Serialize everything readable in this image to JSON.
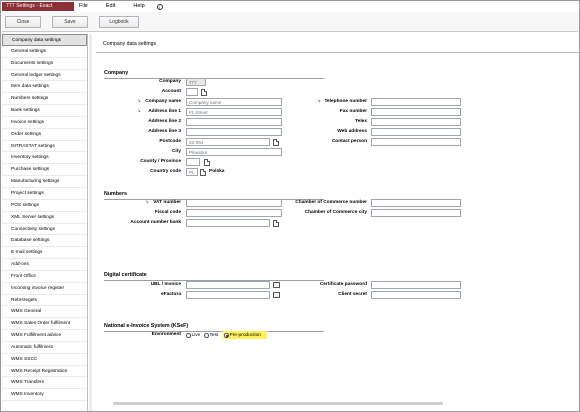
{
  "window": {
    "title": "777 Settings - Exact"
  },
  "menu": {
    "file": "File",
    "edit": "Edit",
    "help": "Help"
  },
  "toolbar": {
    "close": "Close",
    "save": "Save",
    "logbook": "Logbook"
  },
  "sidebar": {
    "items": [
      "Company data settings",
      "General settings",
      "Documents settings",
      "General ledger settings",
      "Item data settings",
      "Numbers settings",
      "Bank settings",
      "Invoice settings",
      "Order settings",
      "INTRASTAT settings",
      "Inventory settings",
      "Purchase settings",
      "Manufacturing settings",
      "Project settings",
      "POS settings",
      "XML Server settings",
      "Connectivity settings",
      "Database settings",
      "E-mail settings",
      "Add-ons",
      "Front Office",
      "Incoming invoice register",
      "Rebrsregels",
      "WMS General",
      "WMS Sales Order fulfilment",
      "WMS Fulfillment advice",
      "Automatic fulfilment",
      "WMS SSCC",
      "WMS Receipt Registration",
      "WMS Transfers",
      "WMS Inventory"
    ],
    "active_index": 0
  },
  "main": {
    "title": "Company data settings",
    "company": {
      "heading": "Company",
      "company_label": "Company",
      "company_value": "777",
      "account_label": "Account",
      "company_name_label": "Company name",
      "company_name_placeholder": "Company name",
      "address1_label": "Address line 1",
      "address1_value": "#1 Street",
      "address2_label": "Address line 2",
      "address3_label": "Address line 3",
      "postcode_label": "Postcode",
      "postcode_value": "62-064",
      "city_label": "City",
      "city_value": "Plewiska",
      "county_label": "County / Province",
      "country_label": "Country code",
      "country_value": "PL",
      "country_name": "Polska",
      "telephone_label": "Telephone number",
      "fax_label": "Fax number",
      "telex_label": "Telex",
      "web_label": "Web address",
      "contact_label": "Contact person"
    },
    "numbers": {
      "heading": "Numbers",
      "vat_label": "VAT number",
      "fiscal_label": "Fiscal code",
      "bank_label": "Account number bank",
      "coc_label": "Chamber of Commerce number",
      "coc_city_label": "Chamber of Commerce city"
    },
    "digital": {
      "heading": "Digital certificate",
      "ubl_label": "UBL / Invoice",
      "efactura_label": "eFactura",
      "cert_pwd_label": "Certificate password",
      "client_secret_label": "Client secret"
    },
    "ksef": {
      "heading": "National e-Invoice System (KSeF)",
      "environment_label": "Environment",
      "options": [
        "Live",
        "Test",
        "Pre-production"
      ],
      "selected": "Pre-production"
    }
  },
  "colors": {
    "title_bg": "#8c2f36",
    "highlight": "#fff15a"
  }
}
